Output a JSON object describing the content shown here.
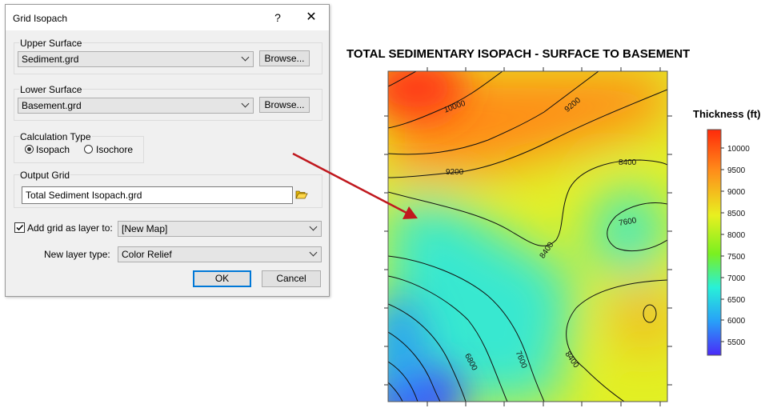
{
  "dialog": {
    "title": "Grid Isopach",
    "help_label": "?",
    "close_label": "✕",
    "upper_surface": {
      "label": "Upper Surface",
      "value": "Sediment.grd",
      "browse_label": "Browse..."
    },
    "lower_surface": {
      "label": "Lower Surface",
      "value": "Basement.grd",
      "browse_label": "Browse..."
    },
    "calc_type": {
      "label": "Calculation Type",
      "options": [
        "Isopach",
        "Isochore"
      ],
      "selected": "Isopach"
    },
    "output_grid": {
      "label": "Output Grid",
      "value": "Total Sediment Isopach.grd"
    },
    "add_layer": {
      "label": "Add grid as layer to:",
      "checked": true,
      "value": "[New Map]"
    },
    "layer_type": {
      "label": "New layer type:",
      "value": "Color Relief"
    },
    "ok_label": "OK",
    "cancel_label": "Cancel"
  },
  "map": {
    "title": "TOTAL SEDIMENTARY ISOPACH - SURFACE TO BASEMENT",
    "contour_labels": [
      "10000",
      "9200",
      "9200",
      "8400",
      "7600",
      "8400",
      "8400",
      "6800",
      "7600"
    ],
    "arrow_color": "#c0181e"
  },
  "colorbar": {
    "title": "Thickness (ft)",
    "ticks": [
      "10000",
      "9500",
      "9000",
      "8500",
      "8000",
      "7500",
      "7000",
      "6500",
      "6000",
      "5500"
    ],
    "colors": [
      "#ff2a0a",
      "#ff8c1a",
      "#e8f020",
      "#7af020",
      "#28f0d8",
      "#28a0f8",
      "#4a2af8"
    ]
  }
}
